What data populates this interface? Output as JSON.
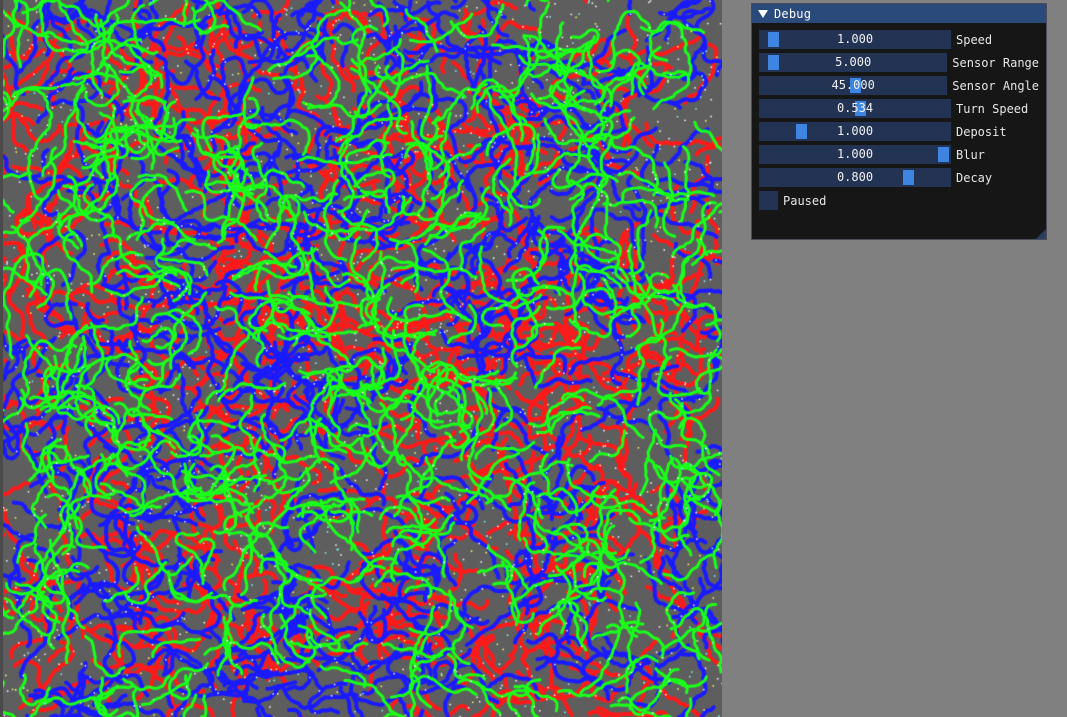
{
  "window": {
    "title": "Debug"
  },
  "sliders": [
    {
      "id": "speed",
      "label": "Speed",
      "value_text": "1.000",
      "fraction": 0.04
    },
    {
      "id": "sensor-range",
      "label": "Sensor Range",
      "value_text": "5.000",
      "fraction": 0.04
    },
    {
      "id": "sensor-angle",
      "label": "Sensor Angle",
      "value_text": "45.000",
      "fraction": 0.5
    },
    {
      "id": "turn-speed",
      "label": "Turn Speed",
      "value_text": "0.534",
      "fraction": 0.53
    },
    {
      "id": "deposit",
      "label": "Deposit",
      "value_text": "1.000",
      "fraction": 0.2
    },
    {
      "id": "blur",
      "label": "Blur",
      "value_text": "1.000",
      "fraction": 1.0
    },
    {
      "id": "decay",
      "label": "Decay",
      "value_text": "0.800",
      "fraction": 0.8
    }
  ],
  "paused": {
    "label": "Paused",
    "checked": false
  },
  "colors": {
    "trail_red": "#ff1a1a",
    "trail_green": "#1aff1a",
    "trail_blue": "#1a1aff",
    "background": "#808080",
    "slider_bg": "#223354",
    "slider_grab": "#3d85e0",
    "title_bar": "#294a7a"
  }
}
